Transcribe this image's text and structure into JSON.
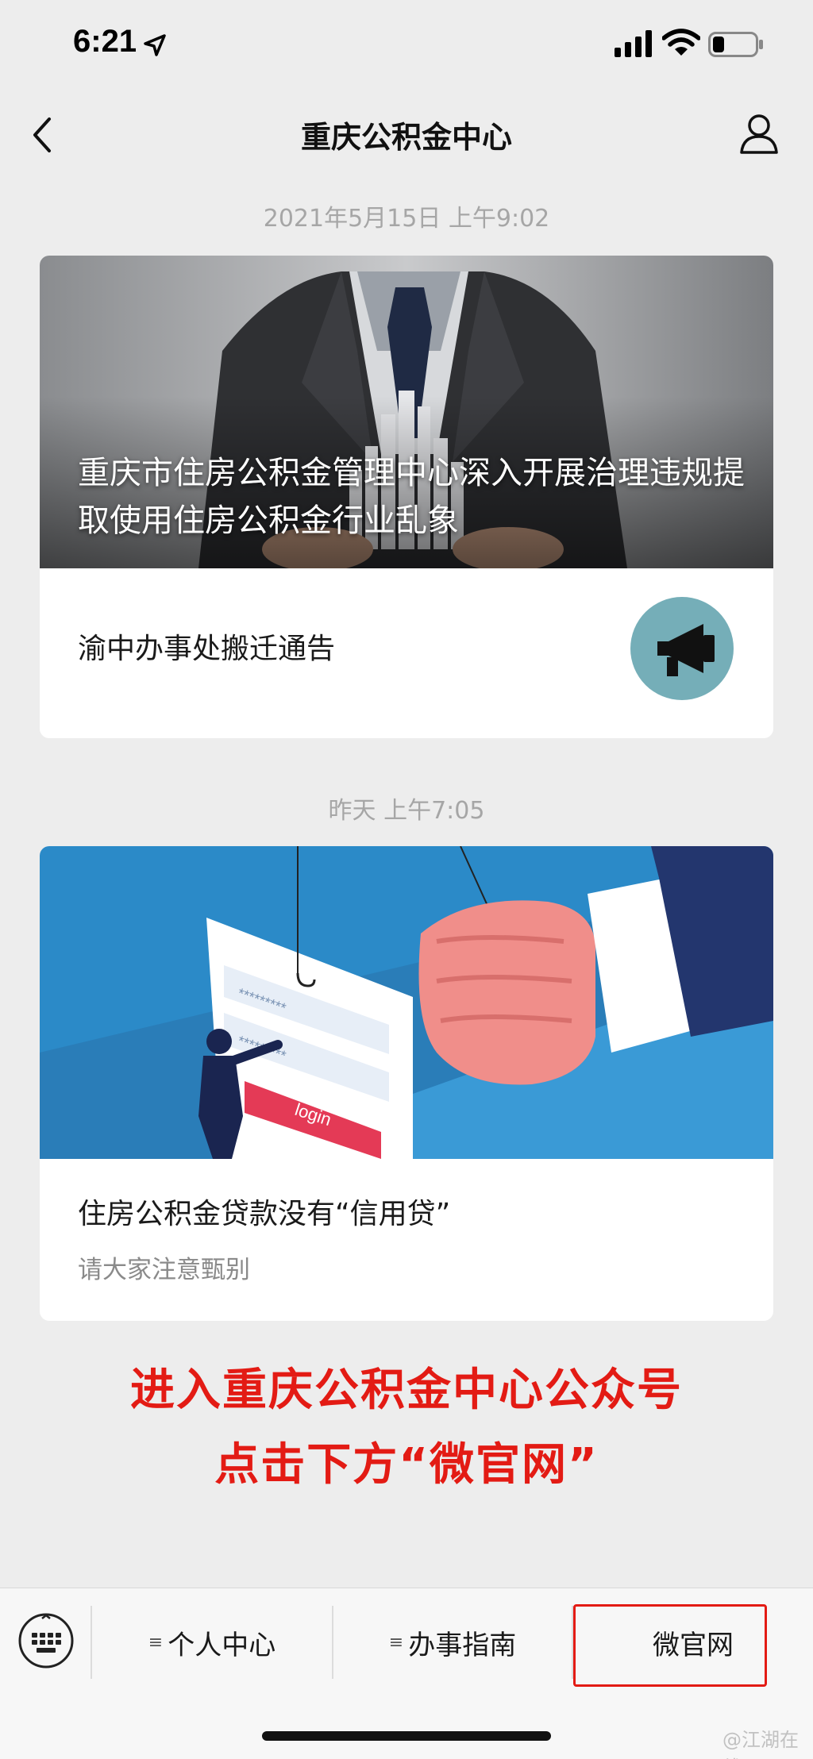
{
  "status_bar": {
    "time": "6:21",
    "icons": [
      "location-arrow-icon",
      "signal-icon",
      "wifi-icon",
      "battery-icon"
    ]
  },
  "nav": {
    "title": "重庆公积金中心",
    "left_icon": "back-chevron-icon",
    "right_icon": "profile-icon"
  },
  "messages": [
    {
      "timestamp": "2021年5月15日 上午9:02",
      "cover": {
        "headline": "重庆市住房公积金管理中心深入开展治理违规提取使用住房公积金行业乱象",
        "image": "man-in-suit-holding-city-model"
      },
      "sub_item": {
        "title": "渝中办事处搬迁通告",
        "thumbnail": "megaphone-icon"
      }
    },
    {
      "timestamp": "昨天 上午7:05",
      "cover": {
        "image": "fishing-hook-login-form-illustration",
        "login_label": "login",
        "password_mask": "*********"
      },
      "title": "住房公积金贷款没有“信用贷”",
      "subtitle": "请大家注意甄别"
    }
  ],
  "overlay": {
    "line1": "进入重庆公积金中心公众号",
    "line2": "点击下方“微官网”"
  },
  "bottom_menu": {
    "keyboard_icon": "keyboard-icon",
    "items": [
      {
        "label": "个人中心",
        "has_submenu": true
      },
      {
        "label": "办事指南",
        "has_submenu": true
      },
      {
        "label": "微官网",
        "has_submenu": false
      }
    ],
    "menu_glyph": "≡",
    "highlighted_item": "微官网"
  },
  "watermark": "@江湖在线",
  "colors": {
    "background": "#ededed",
    "overlay_red": "#e31b14",
    "timestamp_gray": "#a6a6a6",
    "card_bg": "#ffffff"
  }
}
